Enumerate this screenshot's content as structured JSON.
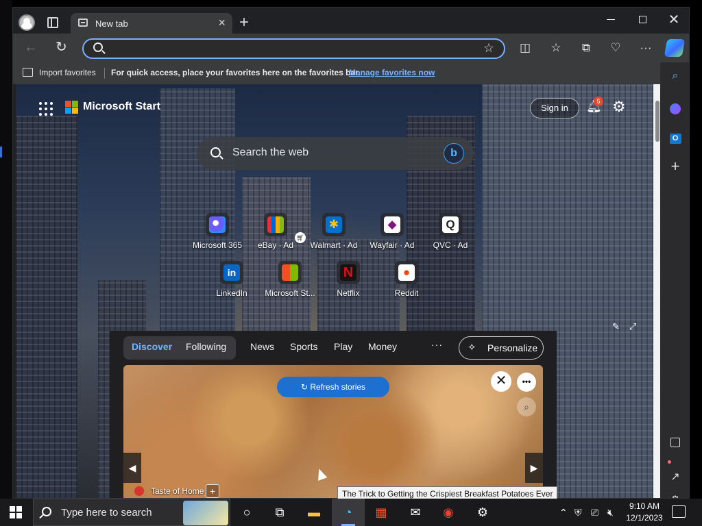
{
  "browser": {
    "tab_title": "New tab",
    "address_placeholder": "",
    "favorites_bar": {
      "import_label": "Import favorites",
      "hint": "For quick access, place your favorites here on the favorites bar.",
      "manage_link": "Manage favorites now"
    }
  },
  "newtab": {
    "brand": "Microsoft Start",
    "sign_in": "Sign in",
    "notification_count": "5",
    "search_label": "Search the web",
    "bing_glyph": "b",
    "quick_links": [
      {
        "label": "Microsoft 365",
        "icon": "microsoft-365-icon",
        "glyph": "",
        "color": "#6a5cff"
      },
      {
        "label": "eBay · Ad",
        "icon": "ebay-icon",
        "glyph": "",
        "color": "#e53238"
      },
      {
        "label": "Walmart · Ad",
        "icon": "walmart-icon",
        "glyph": "✱",
        "color": "#0071ce"
      },
      {
        "label": "Wayfair · Ad",
        "icon": "wayfair-icon",
        "glyph": "◆",
        "color": "#7f187f"
      },
      {
        "label": "QVC · Ad",
        "icon": "qvc-icon",
        "glyph": "Q",
        "color": "#ffffff"
      },
      {
        "label": "LinkedIn",
        "icon": "linkedin-icon",
        "glyph": "in",
        "color": "#0a66c2"
      },
      {
        "label": "Microsoft St...",
        "icon": "microsoft-store-icon",
        "glyph": "",
        "color": "#f25022"
      },
      {
        "label": "Netflix",
        "icon": "netflix-icon",
        "glyph": "N",
        "color": "#141414"
      },
      {
        "label": "Reddit",
        "icon": "reddit-icon",
        "glyph": "●",
        "color": "#ff4500"
      }
    ]
  },
  "feed": {
    "pills": [
      "Discover",
      "Following"
    ],
    "tabs": [
      "News",
      "Sports",
      "Play",
      "Money"
    ],
    "more": "···",
    "personalize": "Personalize",
    "refresh": "Refresh stories",
    "source_name": "Taste of Home",
    "follow_symbol": "+",
    "tooltip": "The Trick to Getting the Crispiest Breakfast Potatoes Ever"
  },
  "taskbar": {
    "search_placeholder": "Type here to search",
    "time": "9:10 AM",
    "date": "12/1/2023"
  }
}
